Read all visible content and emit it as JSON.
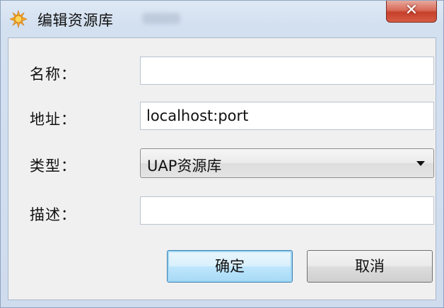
{
  "window": {
    "title": "编辑资源库",
    "close_glyph": "✕",
    "app_icon": "sun-gear-icon"
  },
  "form": {
    "name_label": "名称：",
    "name_value": "",
    "address_label": "地址：",
    "address_value": "localhost:port",
    "type_label": "类型：",
    "type_selected": "UAP资源库",
    "description_label": "描述：",
    "description_value": ""
  },
  "buttons": {
    "ok_label": "确定",
    "cancel_label": "取消"
  },
  "colors": {
    "close_button": "#c6402b",
    "default_button_border": "#3c7fb1",
    "title_bar": "#d3e0f0"
  }
}
